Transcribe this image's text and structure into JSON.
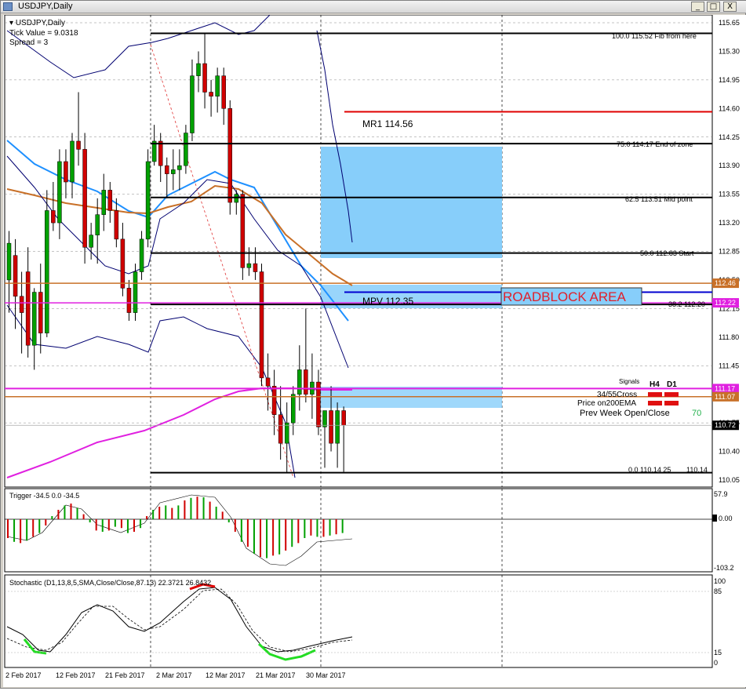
{
  "window": {
    "title": "USDJPY,Daily",
    "buttons": {
      "minimize": "_",
      "maximize": "□",
      "close": "X"
    }
  },
  "info": {
    "symbol": "USDJPY,Daily",
    "tick_value": "Tick Value = 9.0318",
    "spread": "Spread = 3"
  },
  "price_axis": {
    "labels": [
      "115.65",
      "115.30",
      "114.95",
      "114.60",
      "114.25",
      "113.90",
      "113.55",
      "113.20",
      "112.85",
      "112.50",
      "112.15",
      "111.80",
      "111.45",
      "111.10",
      "110.75",
      "110.40",
      "110.05"
    ],
    "badges": [
      {
        "value": "112.46",
        "color": "#c87028"
      },
      {
        "value": "112.22",
        "color": "#e020e0"
      },
      {
        "value": "111.17",
        "color": "#e020e0"
      },
      {
        "value": "111.07",
        "color": "#c87028"
      },
      {
        "value": "110.72",
        "color": "#000000"
      }
    ]
  },
  "time_axis": [
    "2 Feb 2017",
    "12 Feb 2017",
    "21 Feb 2017",
    "2 Mar 2017",
    "12 Mar 2017",
    "21 Mar 2017",
    "30 Mar 2017"
  ],
  "fib_labels": {
    "f100": "100.0  115.52    Fib from here",
    "f75": "75.0    114.17    End of zone",
    "f62": "62.5    113.51    Mid point",
    "f50": "50.0    112.83    Start",
    "f38": "38.2    112.20",
    "f0a": "0.0    110.14 25",
    "f0b": "110.14"
  },
  "pivot_labels": {
    "mr1": "MR1   114.56",
    "mpv": "MPV   112.35"
  },
  "roadblock_label": "ROADBLOCK AREA",
  "signals": {
    "header": "Signals",
    "h4": "H4",
    "d1": "D1",
    "row1": "34/55Cross",
    "row2": "Price on200EMA",
    "row3": "Prev Week Open/Close",
    "row3_value": "70"
  },
  "trigger": {
    "title": "Trigger -34.5 0.0 -34.5",
    "axis": [
      "57.9",
      "0.00",
      "-103.2"
    ]
  },
  "stochastic": {
    "title": "Stochastic (D1,13,8,5,SMA,Close/Close,87.13) 22.3721 26.8432",
    "axis": [
      "100",
      "85",
      "15",
      "0"
    ]
  },
  "colors": {
    "bull": "#00a000",
    "bear": "#d00000",
    "fib": "#000000",
    "mr1": "#e00000",
    "mpv": "#0000d0",
    "ema200": "#e020e0",
    "ema_orange": "#c87028",
    "ema_blue": "#1e90ff",
    "zone": "#87cefa"
  },
  "chart_data": {
    "type": "candlestick",
    "symbol": "USDJPY",
    "timeframe": "Daily",
    "ylim": [
      110.0,
      115.8
    ],
    "fib_levels": [
      {
        "level": 100.0,
        "price": 115.52
      },
      {
        "level": 75.0,
        "price": 114.17
      },
      {
        "level": 62.5,
        "price": 113.51
      },
      {
        "level": 50.0,
        "price": 112.83
      },
      {
        "level": 38.2,
        "price": 112.2
      },
      {
        "level": 0.0,
        "price": 110.14
      }
    ],
    "pivots": {
      "MR1": 114.56,
      "MPV": 112.35
    },
    "candles": [
      {
        "o": 112.5,
        "h": 113.1,
        "l": 112.1,
        "c": 112.95
      },
      {
        "o": 112.8,
        "h": 113.0,
        "l": 111.9,
        "c": 112.3
      },
      {
        "o": 112.3,
        "h": 112.6,
        "l": 111.6,
        "c": 112.1
      },
      {
        "o": 112.6,
        "h": 112.9,
        "l": 111.55,
        "c": 111.7
      },
      {
        "o": 111.7,
        "h": 112.4,
        "l": 111.4,
        "c": 112.35
      },
      {
        "o": 112.35,
        "h": 112.7,
        "l": 111.6,
        "c": 111.85
      },
      {
        "o": 111.85,
        "h": 113.6,
        "l": 111.8,
        "c": 113.35
      },
      {
        "o": 113.35,
        "h": 113.7,
        "l": 113.1,
        "c": 113.2
      },
      {
        "o": 113.2,
        "h": 114.1,
        "l": 113.0,
        "c": 113.95
      },
      {
        "o": 113.95,
        "h": 114.1,
        "l": 113.5,
        "c": 113.7
      },
      {
        "o": 113.7,
        "h": 114.3,
        "l": 113.5,
        "c": 114.2
      },
      {
        "o": 114.2,
        "h": 114.8,
        "l": 113.9,
        "c": 114.1
      },
      {
        "o": 114.1,
        "h": 114.3,
        "l": 112.7,
        "c": 112.9
      },
      {
        "o": 112.9,
        "h": 113.2,
        "l": 112.75,
        "c": 113.05
      },
      {
        "o": 113.05,
        "h": 113.5,
        "l": 112.7,
        "c": 113.3
      },
      {
        "o": 113.3,
        "h": 113.8,
        "l": 113.1,
        "c": 113.6
      },
      {
        "o": 113.6,
        "h": 113.7,
        "l": 113.2,
        "c": 113.35
      },
      {
        "o": 113.35,
        "h": 113.5,
        "l": 112.9,
        "c": 113.0
      },
      {
        "o": 113.0,
        "h": 113.2,
        "l": 112.3,
        "c": 112.4
      },
      {
        "o": 112.4,
        "h": 112.5,
        "l": 112.0,
        "c": 112.1
      },
      {
        "o": 112.1,
        "h": 112.7,
        "l": 112.0,
        "c": 112.6
      },
      {
        "o": 112.6,
        "h": 113.1,
        "l": 112.5,
        "c": 113.0
      },
      {
        "o": 113.0,
        "h": 114.1,
        "l": 112.9,
        "c": 113.95
      },
      {
        "o": 113.95,
        "h": 114.4,
        "l": 113.9,
        "c": 114.2
      },
      {
        "o": 114.2,
        "h": 114.3,
        "l": 113.7,
        "c": 113.9
      },
      {
        "o": 113.9,
        "h": 114.0,
        "l": 113.5,
        "c": 113.8
      },
      {
        "o": 113.8,
        "h": 114.1,
        "l": 113.6,
        "c": 113.85
      },
      {
        "o": 113.85,
        "h": 114.1,
        "l": 113.6,
        "c": 113.9
      },
      {
        "o": 113.9,
        "h": 114.4,
        "l": 113.8,
        "c": 114.3
      },
      {
        "o": 114.3,
        "h": 115.2,
        "l": 114.2,
        "c": 115.0
      },
      {
        "o": 115.0,
        "h": 115.3,
        "l": 114.8,
        "c": 115.15
      },
      {
        "o": 115.15,
        "h": 115.52,
        "l": 114.6,
        "c": 114.8
      },
      {
        "o": 114.8,
        "h": 114.95,
        "l": 114.5,
        "c": 114.75
      },
      {
        "o": 114.75,
        "h": 115.1,
        "l": 114.55,
        "c": 115.0
      },
      {
        "o": 115.0,
        "h": 115.1,
        "l": 114.4,
        "c": 114.6
      },
      {
        "o": 114.6,
        "h": 114.7,
        "l": 113.3,
        "c": 113.45
      },
      {
        "o": 113.45,
        "h": 113.6,
        "l": 113.3,
        "c": 113.55
      },
      {
        "o": 113.55,
        "h": 113.6,
        "l": 112.5,
        "c": 112.65
      },
      {
        "o": 112.65,
        "h": 112.9,
        "l": 112.55,
        "c": 112.7
      },
      {
        "o": 112.7,
        "h": 112.9,
        "l": 112.5,
        "c": 112.6
      },
      {
        "o": 112.6,
        "h": 112.7,
        "l": 111.2,
        "c": 111.3
      },
      {
        "o": 111.3,
        "h": 111.6,
        "l": 110.9,
        "c": 111.2
      },
      {
        "o": 111.2,
        "h": 111.4,
        "l": 110.6,
        "c": 110.85
      },
      {
        "o": 110.85,
        "h": 111.2,
        "l": 110.3,
        "c": 110.5
      },
      {
        "o": 110.5,
        "h": 111.0,
        "l": 110.14,
        "c": 110.75
      },
      {
        "o": 110.75,
        "h": 111.2,
        "l": 110.6,
        "c": 111.1
      },
      {
        "o": 111.1,
        "h": 111.7,
        "l": 110.9,
        "c": 111.4
      },
      {
        "o": 111.4,
        "h": 112.15,
        "l": 111.0,
        "c": 111.1
      },
      {
        "o": 111.1,
        "h": 111.6,
        "l": 110.8,
        "c": 111.25
      },
      {
        "o": 111.25,
        "h": 111.4,
        "l": 110.6,
        "c": 110.7
      },
      {
        "o": 110.7,
        "h": 110.9,
        "l": 110.2,
        "c": 110.9
      },
      {
        "o": 110.9,
        "h": 111.2,
        "l": 110.4,
        "c": 110.5
      },
      {
        "o": 110.5,
        "h": 111.0,
        "l": 110.2,
        "c": 110.9
      },
      {
        "o": 110.9,
        "h": 110.95,
        "l": 110.15,
        "c": 110.72
      }
    ]
  }
}
